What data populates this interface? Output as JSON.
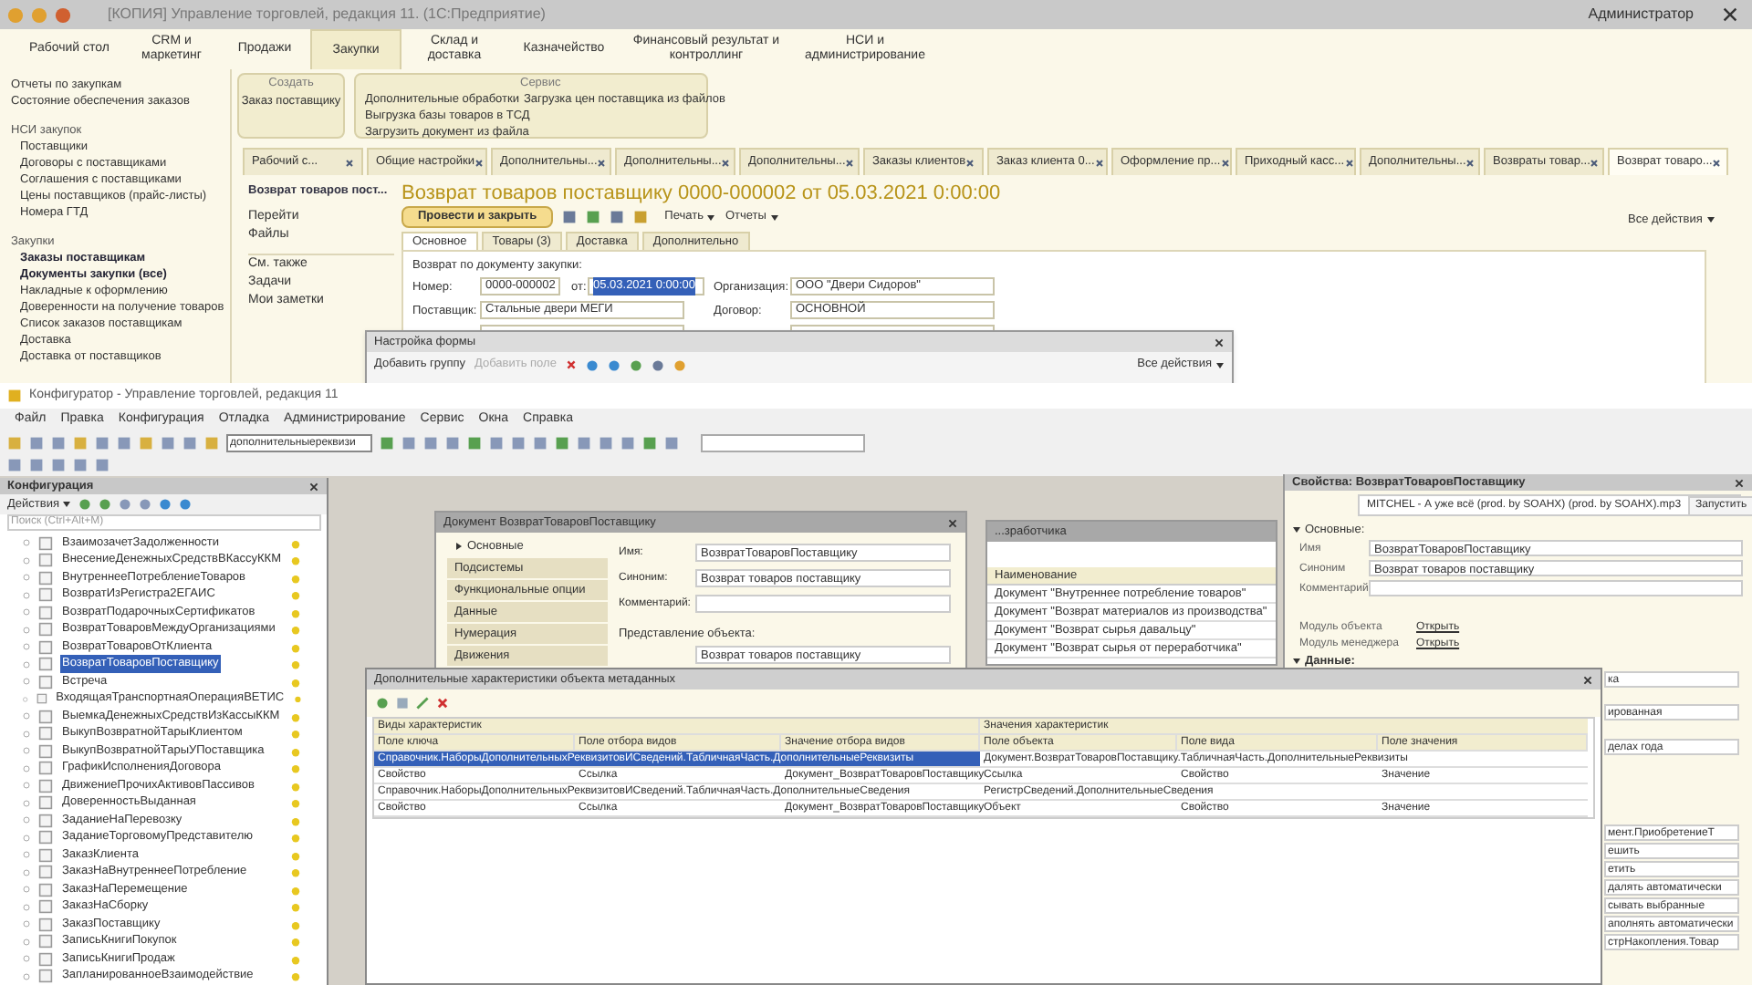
{
  "enterprise": {
    "title": "[КОПИЯ] Управление торговлей, редакция 11. (1С:Предприятие)",
    "user": "Администратор",
    "sections": [
      {
        "label": "Рабочий стол",
        "selected": false
      },
      {
        "label": "CRM и маркетинг",
        "selected": false
      },
      {
        "label": "Продажи",
        "selected": false
      },
      {
        "label": "Закупки",
        "selected": true
      },
      {
        "label": "Склад и доставка",
        "selected": false
      },
      {
        "label": "Казначейство",
        "selected": false
      },
      {
        "label": "Финансовый результат и контроллинг",
        "selected": false
      },
      {
        "label": "НСИ и администрирование",
        "selected": false
      }
    ],
    "nav": [
      {
        "kind": "link",
        "label": "Отчеты по закупкам"
      },
      {
        "kind": "link",
        "label": "Состояние обеспечения заказов"
      },
      {
        "kind": "header",
        "label": "НСИ закупок"
      },
      {
        "kind": "sub",
        "label": "Поставщики"
      },
      {
        "kind": "sub",
        "label": "Договоры с поставщиками"
      },
      {
        "kind": "sub",
        "label": "Соглашения с поставщиками"
      },
      {
        "kind": "sub",
        "label": "Цены поставщиков (прайс-листы)"
      },
      {
        "kind": "sub",
        "label": "Номера ГТД"
      },
      {
        "kind": "header",
        "label": "Закупки"
      },
      {
        "kind": "bold",
        "label": "Заказы поставщикам"
      },
      {
        "kind": "bold",
        "label": "Документы закупки (все)"
      },
      {
        "kind": "sub",
        "label": "Накладные к оформлению"
      },
      {
        "kind": "sub",
        "label": "Доверенности на получение товаров"
      },
      {
        "kind": "sub",
        "label": "Список заказов поставщикам"
      },
      {
        "kind": "sub",
        "label": "Доставка"
      },
      {
        "kind": "sub",
        "label": "Доставка от поставщиков"
      }
    ],
    "actions": {
      "create_title": "Создать",
      "create": [
        "Заказ поставщику"
      ],
      "service_title": "Сервис",
      "service": [
        "Дополнительные обработки",
        "Выгрузка базы товаров в ТСД",
        "Загрузить документ из файла"
      ],
      "service_2": [
        "Загрузка цен поставщика из файлов"
      ]
    },
    "open_tabs": [
      {
        "label": "Рабочий с...",
        "selected": false
      },
      {
        "label": "Общие настройки",
        "selected": false
      },
      {
        "label": "Дополнительны...",
        "selected": false
      },
      {
        "label": "Дополнительны...",
        "selected": false
      },
      {
        "label": "Дополнительны...",
        "selected": false
      },
      {
        "label": "Заказы клиентов",
        "selected": false
      },
      {
        "label": "Заказ клиента 0...",
        "selected": false
      },
      {
        "label": "Оформление пр...",
        "selected": false
      },
      {
        "label": "Приходный касс...",
        "selected": false
      },
      {
        "label": "Дополнительны...",
        "selected": false
      },
      {
        "label": "Возвраты товар...",
        "selected": false
      },
      {
        "label": "Возврат товаро...",
        "selected": true
      }
    ],
    "form_nav": {
      "title": "Возврат товаров пост...",
      "links": [
        "Перейти",
        "Файлы"
      ],
      "see_also": "См. также",
      "more": [
        "Задачи",
        "Мои заметки"
      ]
    },
    "document": {
      "title": "Возврат товаров поставщику 0000-000002 от 05.03.2021 0:00:00",
      "post_button": "Провести и закрыть",
      "print": "Печать",
      "reports": "Отчеты",
      "all_actions": "Все действия",
      "tabs": [
        {
          "label": "Основное",
          "selected": true
        },
        {
          "label": "Товары (3)",
          "selected": false
        },
        {
          "label": "Доставка",
          "selected": false
        },
        {
          "label": "Дополнительно",
          "selected": false
        }
      ],
      "basis": "Возврат по документу закупки:",
      "number_label": "Номер:",
      "number": "0000-000002",
      "date_label": "от:",
      "date": "05.03.2021 0:00:00",
      "org_label": "Организация:",
      "org": "ООО \"Двери Сидоров\"",
      "supplier_label": "Поставщик:",
      "supplier": "Стальные двери МЕГИ",
      "contract_label": "Договор:",
      "contract": "ОСНОВНОЙ"
    },
    "form_settings": {
      "title": "Настройка формы",
      "add_group": "Добавить группу",
      "add_field": "Добавить поле",
      "all_actions": "Все действия"
    }
  },
  "configurator": {
    "title": "Конфигуратор - Управление торговлей, редакция 11",
    "menu": [
      "Файл",
      "Правка",
      "Конфигурация",
      "Отладка",
      "Администрирование",
      "Сервис",
      "Окна",
      "Справка"
    ],
    "search": "дополнительныереквизи",
    "tree_title": "Конфигурация",
    "tree_actions": "Действия",
    "tree_search": {
      "placeholder": "Поиск (Ctrl+Alt+M)"
    },
    "tree": [
      {
        "label": "ВзаимозачетЗадолженности",
        "selected": false
      },
      {
        "label": "ВнесениеДенежныхСредствВКассуККМ",
        "selected": false
      },
      {
        "label": "ВнутреннееПотреблениеТоваров",
        "selected": false
      },
      {
        "label": "ВозвратИзРегистра2ЕГАИС",
        "selected": false
      },
      {
        "label": "ВозвратПодарочныхСертификатов",
        "selected": false
      },
      {
        "label": "ВозвратТоваровМеждуОрганизациями",
        "selected": false
      },
      {
        "label": "ВозвратТоваровОтКлиента",
        "selected": false
      },
      {
        "label": "ВозвратТоваровПоставщику",
        "selected": true
      },
      {
        "label": "Встреча",
        "selected": false
      },
      {
        "label": "ВходящаяТранспортнаяОперацияВЕТИС",
        "selected": false
      },
      {
        "label": "ВыемкаДенежныхСредствИзКассыККМ",
        "selected": false
      },
      {
        "label": "ВыкупВозвратнойТарыКлиентом",
        "selected": false
      },
      {
        "label": "ВыкупВозвратнойТарыУПоставщика",
        "selected": false
      },
      {
        "label": "ГрафикИсполненияДоговора",
        "selected": false
      },
      {
        "label": "ДвижениеПрочихАктивовПассивов",
        "selected": false
      },
      {
        "label": "ДоверенностьВыданная",
        "selected": false
      },
      {
        "label": "ЗаданиеНаПеревозку",
        "selected": false
      },
      {
        "label": "ЗаданиеТорговомуПредставителю",
        "selected": false
      },
      {
        "label": "ЗаказКлиента",
        "selected": false
      },
      {
        "label": "ЗаказНаВнутреннееПотребление",
        "selected": false
      },
      {
        "label": "ЗаказНаПеремещение",
        "selected": false
      },
      {
        "label": "ЗаказНаСборку",
        "selected": false
      },
      {
        "label": "ЗаказПоставщику",
        "selected": false
      },
      {
        "label": "ЗаписьКнигиПокупок",
        "selected": false
      },
      {
        "label": "ЗаписьКнигиПродаж",
        "selected": false
      },
      {
        "label": "ЗапланированноеВзаимодействие",
        "selected": false
      }
    ],
    "list_title": "...зработчика",
    "list_header": "Наименование",
    "list_rows": [
      "Документ \"Внутреннее потребление товаров\"",
      "Документ \"Возврат материалов из производства\"",
      "Документ \"Возврат сырья давальцу\"",
      "Документ \"Возврат сырья от переработчика\""
    ],
    "doc_window": {
      "title": "Документ ВозвратТоваровПоставщику",
      "sections": [
        {
          "label": "Основные",
          "selected": true
        },
        {
          "label": "Подсистемы",
          "selected": false
        },
        {
          "label": "Функциональные опции",
          "selected": false
        },
        {
          "label": "Данные",
          "selected": false
        },
        {
          "label": "Нумерация",
          "selected": false
        },
        {
          "label": "Движения",
          "selected": false
        }
      ],
      "name_label": "Имя:",
      "name": "ВозвратТоваровПоставщику",
      "synonym_label": "Синоним:",
      "synonym": "Возврат товаров поставщику",
      "comment_label": "Комментарий:",
      "presentation_label": "Представление объекта:",
      "presentation": "Возврат товаров поставщику"
    },
    "properties": {
      "title": "Свойства: ВозвратТоваровПоставщику",
      "notice": "MITCHEL - А уже всё (prod. by SOAHX) (prod. by SOAHX).mp3",
      "run": "Запустить",
      "group": "Основные:",
      "name_label": "Имя",
      "name": "ВозвратТоваровПоставщику",
      "synonym_label": "Синоним",
      "synonym": "Возврат товаров поставщику",
      "comment_label": "Комментарий",
      "object_module": "Модуль объекта",
      "manager_module": "Модуль менеджера",
      "open_object": "Открыть",
      "open_manager": "Открыть",
      "data_group": "Данные:",
      "fragments": [
        "ка",
        "ированная",
        "делах года",
        "мент.ПриобретениеТ",
        "ешить",
        "етить",
        "далять автоматически",
        "сывать выбранные",
        "аполнять автоматически",
        "стрНакопления.Товар"
      ]
    },
    "characteristics": {
      "title": "Дополнительные характеристики объекта метаданных",
      "group_1": "Виды характеристик",
      "group_2": "Значения характеристик",
      "columns": [
        "Поле ключа",
        "Поле отбора видов",
        "Значение отбора видов",
        "Поле объекта",
        "Поле вида",
        "Поле значения"
      ],
      "rows": [
        {
          "kind": "span",
          "selected": true,
          "key": "Справочник.НаборыДополнительныхРеквизитовИСведений.ТабличнаяЧасть.ДополнительныеРеквизиты",
          "object": "Документ.ВозвратТоваровПоставщику.ТабличнаяЧасть.ДополнительныеРеквизиты"
        },
        {
          "kind": "cells",
          "selected": false,
          "cells": [
            "Свойство",
            "Ссылка",
            "Документ_ВозвратТоваровПоставщику",
            "Ссылка",
            "Свойство",
            "Значение"
          ]
        },
        {
          "kind": "span",
          "selected": false,
          "key": "Справочник.НаборыДополнительныхРеквизитовИСведений.ТабличнаяЧасть.ДополнительныеСведения",
          "object": "РегистрСведений.ДополнительныеСведения"
        },
        {
          "kind": "cells",
          "selected": false,
          "cells": [
            "Свойство",
            "Ссылка",
            "Документ_ВозвратТоваровПоставщику",
            "Объект",
            "Свойство",
            "Значение"
          ]
        }
      ]
    }
  }
}
